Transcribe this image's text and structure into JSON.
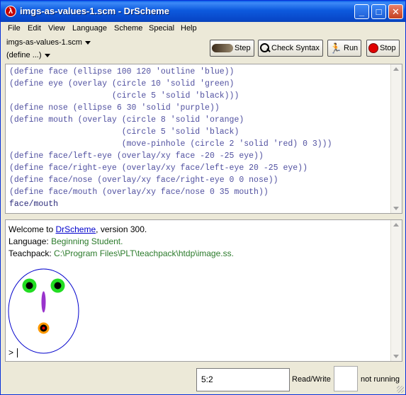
{
  "window": {
    "title": "imgs-as-values-1.scm - DrScheme",
    "app_icon_glyph": "λ",
    "minimize_glyph": "_",
    "maximize_glyph": "□",
    "close_glyph": "✕"
  },
  "menu": {
    "file": "File",
    "edit": "Edit",
    "view": "View",
    "language": "Language",
    "scheme": "Scheme",
    "special": "Special",
    "help": "Help"
  },
  "toolbar": {
    "file_popup": "imgs-as-values-1.scm",
    "define_popup": "(define ...)",
    "step_label": "Step",
    "check_syntax_label": "Check Syntax",
    "run_label": "Run",
    "stop_label": "Stop"
  },
  "definitions": {
    "lines": [
      "(define face (ellipse 100 120 'outline 'blue))",
      "(define eye (overlay (circle 10 'solid 'green)",
      "                     (circle 5 'solid 'black)))",
      "(define nose (ellipse 6 30 'solid 'purple))",
      "(define mouth (overlay (circle 8 'solid 'orange)",
      "                       (circle 5 'solid 'black)",
      "                       (move-pinhole (circle 2 'solid 'red) 0 3)))",
      "(define face/left-eye (overlay/xy face -20 -25 eye))",
      "(define face/right-eye (overlay/xy face/left-eye 20 -25 eye))",
      "(define face/nose (overlay/xy face/right-eye 0 0 nose))",
      "(define face/mouth (overlay/xy face/nose 0 35 mouth))",
      "face/mouth"
    ]
  },
  "interactions": {
    "welcome_prefix": "Welcome to ",
    "welcome_link": "DrScheme",
    "welcome_suffix": ", version 300.",
    "language_label": "Language: ",
    "language_value": "Beginning Student.",
    "teachpack_label": "Teachpack: ",
    "teachpack_value": "C:\\Program Files\\PLT\\teachpack\\htdp\\image.ss.",
    "prompt": ">"
  },
  "status": {
    "position": "5:2",
    "mode": "Read/Write",
    "running": "not running"
  },
  "colors": {
    "face_outline": "#0000cc",
    "eye_outer": "#22dd22",
    "eye_inner": "#000000",
    "nose": "#9933cc",
    "mouth_outer": "#ff9900",
    "mouth_inner": "#000000",
    "mouth_pinhole": "#ee0000"
  }
}
